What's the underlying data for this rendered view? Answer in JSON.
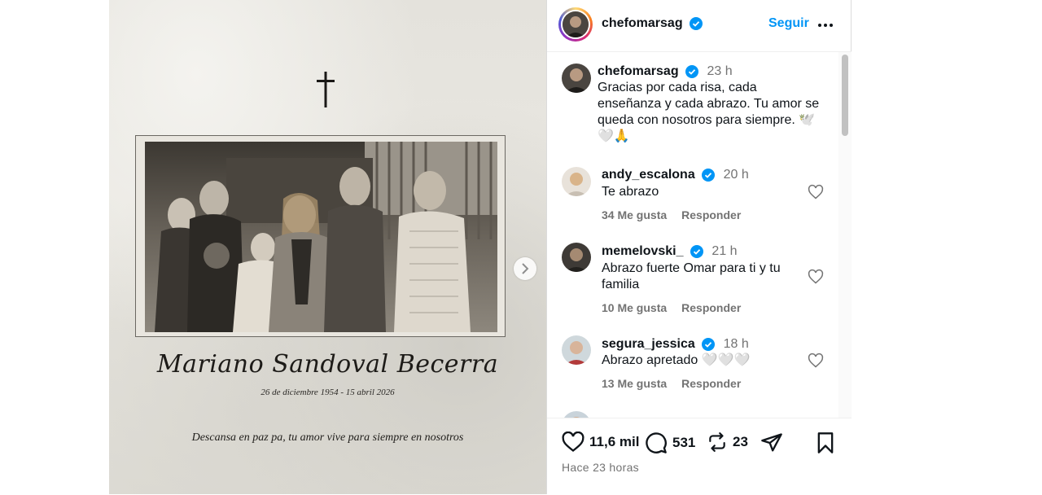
{
  "post": {
    "memorial": {
      "name": "Mariano Sandoval Becerra",
      "dates": "26 de diciembre 1954  -  15 abril 2026",
      "epitaph": "Descansa en paz pa, tu amor vive para siempre en nosotros"
    }
  },
  "header": {
    "username": "chefomarsag",
    "follow_label": "Seguir"
  },
  "caption": {
    "username": "chefomarsag",
    "time": "23 h",
    "lines": [
      "Gracias por cada risa, cada",
      "enseñanza y cada abrazo. Tu amor se",
      "queda con nosotros para siempre. 🕊️",
      "🤍🙏"
    ]
  },
  "comments": [
    {
      "username": "andy_escalona",
      "time": "20 h",
      "lines": [
        "Te abrazo"
      ],
      "likes": "34 Me gusta",
      "reply": "Responder"
    },
    {
      "username": "memelovski_",
      "time": "21 h",
      "lines": [
        "Abrazo fuerte Omar para ti y tu",
        "familia"
      ],
      "likes": "10 Me gusta",
      "reply": "Responder"
    },
    {
      "username": "segura_jessica",
      "time": "18 h",
      "lines": [
        "Abrazo apretado 🤍🤍🤍"
      ],
      "likes": "13 Me gusta",
      "reply": "Responder"
    }
  ],
  "actions": {
    "likes": "11,6 mil",
    "comments": "531",
    "reposts": "23",
    "posted_ago": "Hace 23 horas"
  },
  "colors": {
    "accent": "#0095f6",
    "muted": "#737373",
    "verified": "#0095f6"
  }
}
